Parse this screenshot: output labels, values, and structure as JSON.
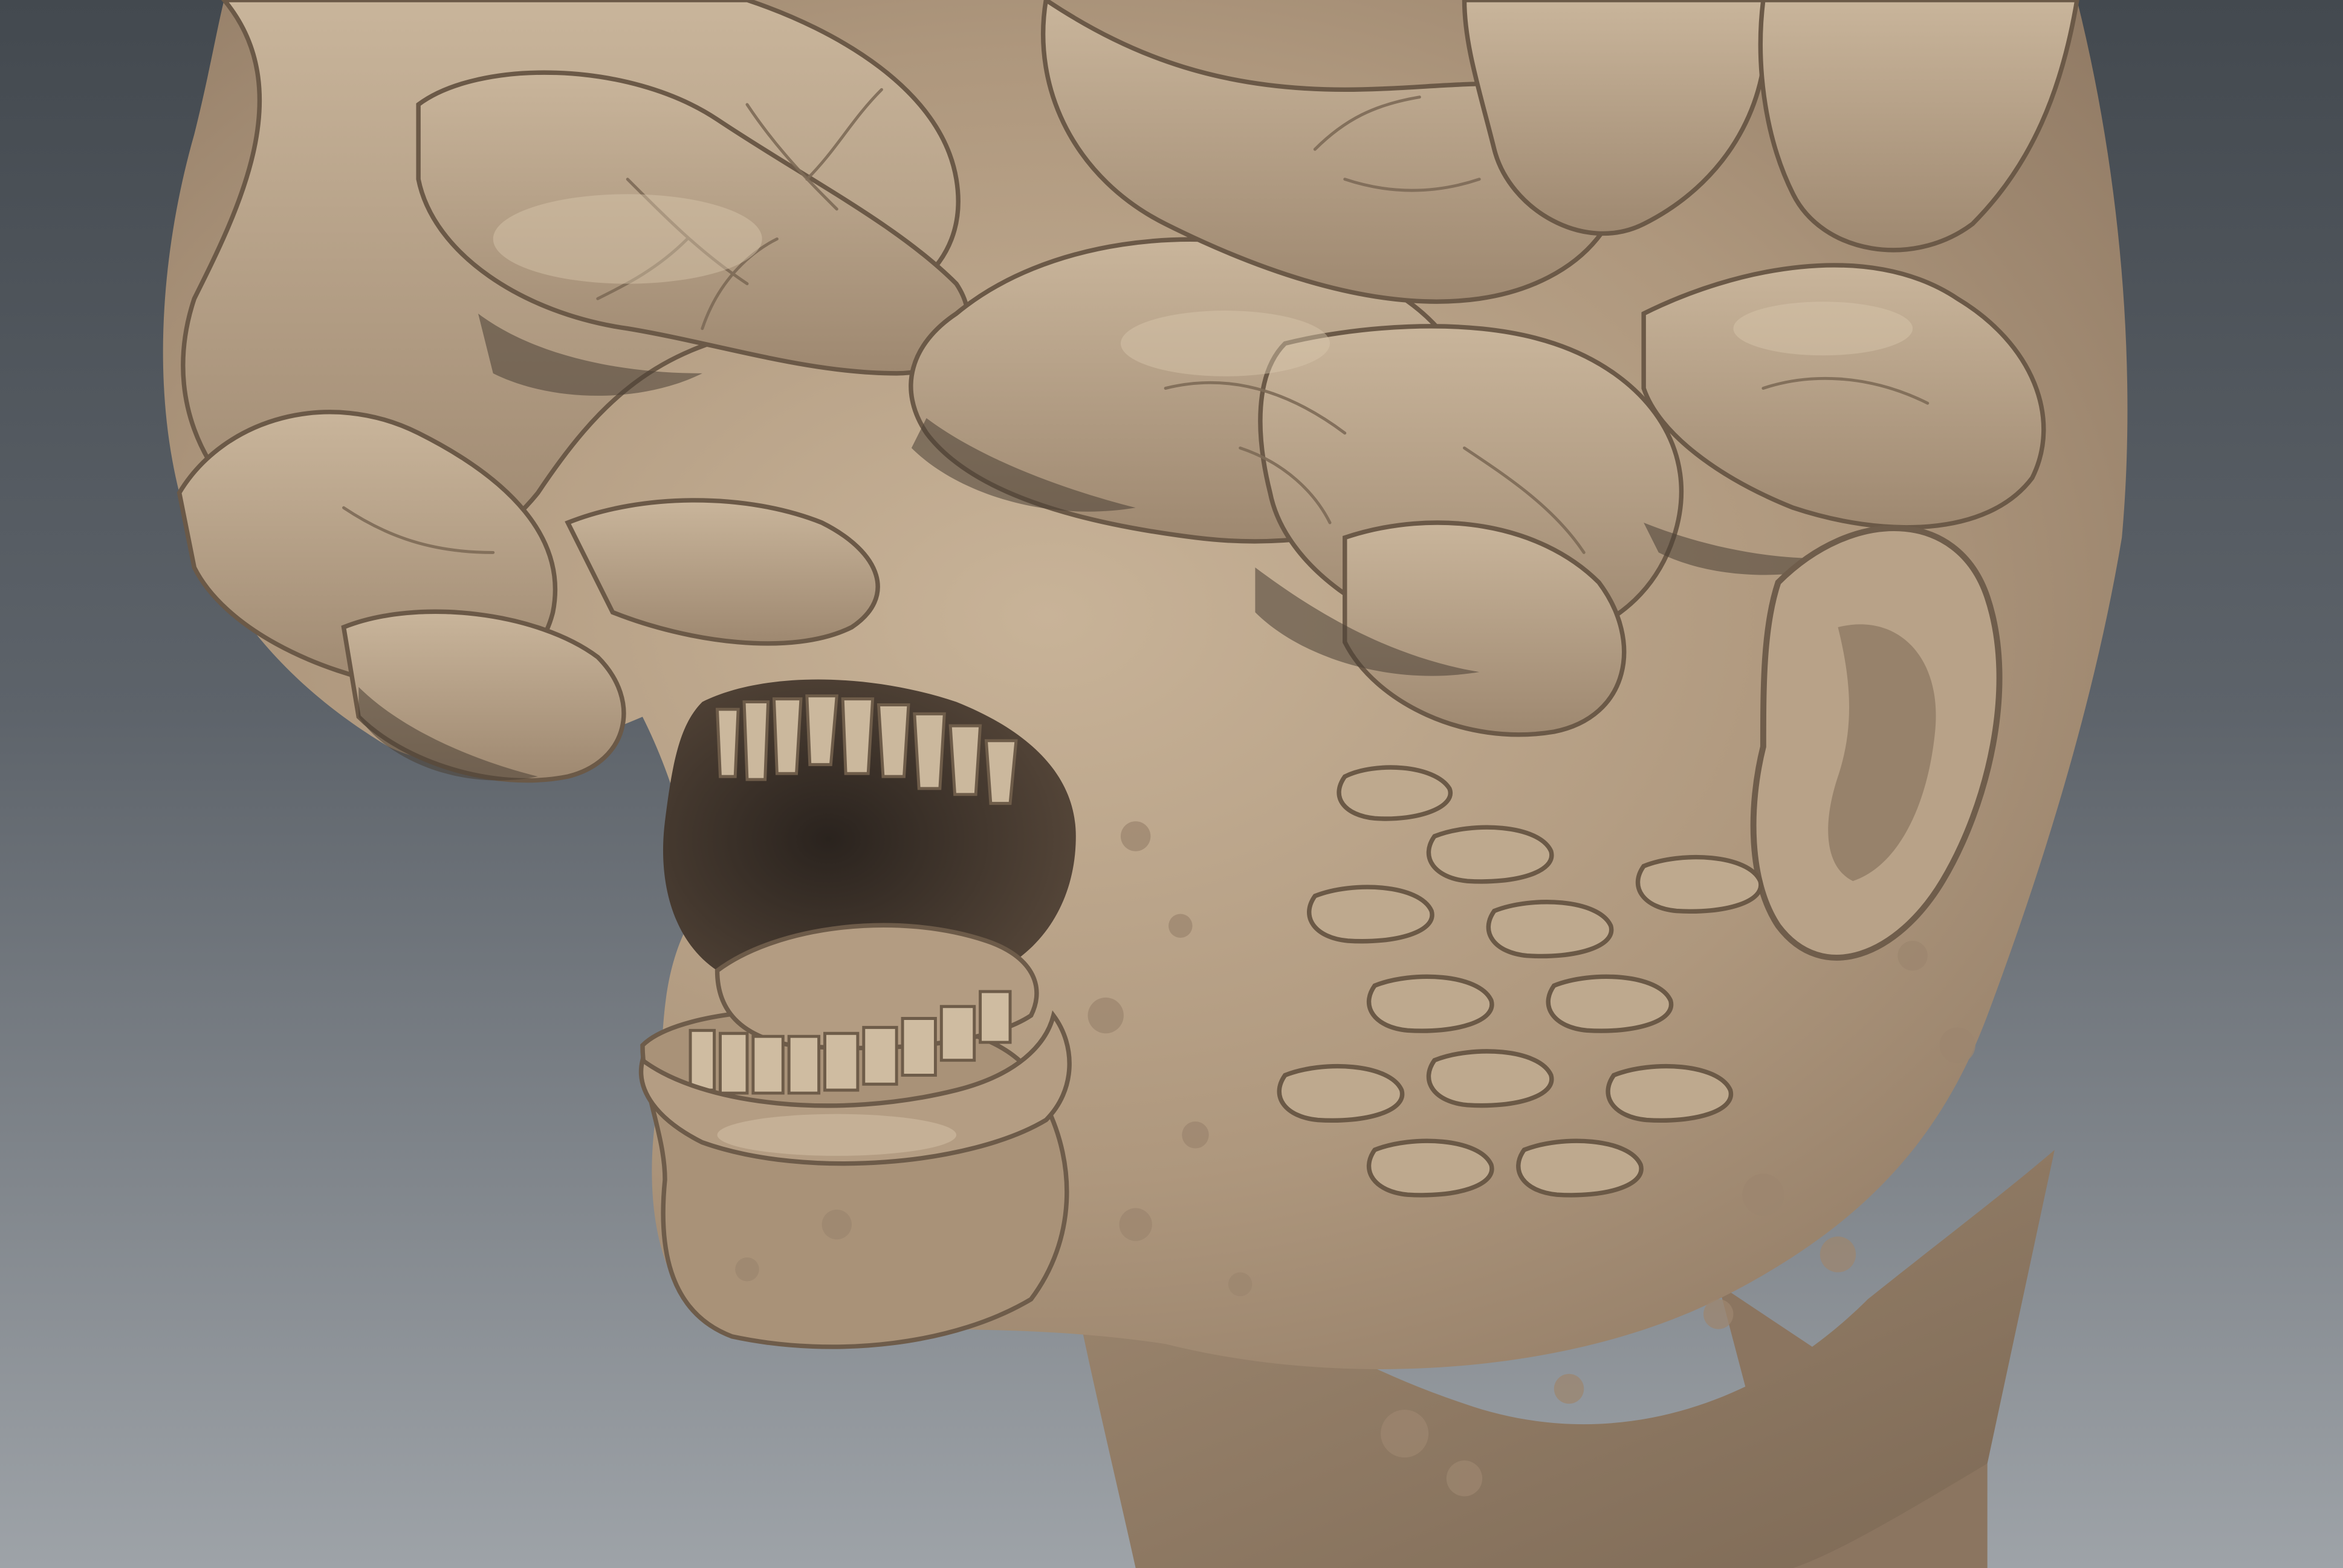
{
  "viewport": {
    "kind": "3d-sculpt-render",
    "subject": "creature-head-bust",
    "background_gradient": [
      "#43494f",
      "#5d636a",
      "#9ea3a8"
    ],
    "material_colors": {
      "base": "#b09a80",
      "light": "#c6b196",
      "mid": "#9c8670",
      "shadow": "#6d5c4a",
      "deep_shadow": "#3b332c",
      "neck_base": "#8c7661"
    }
  }
}
